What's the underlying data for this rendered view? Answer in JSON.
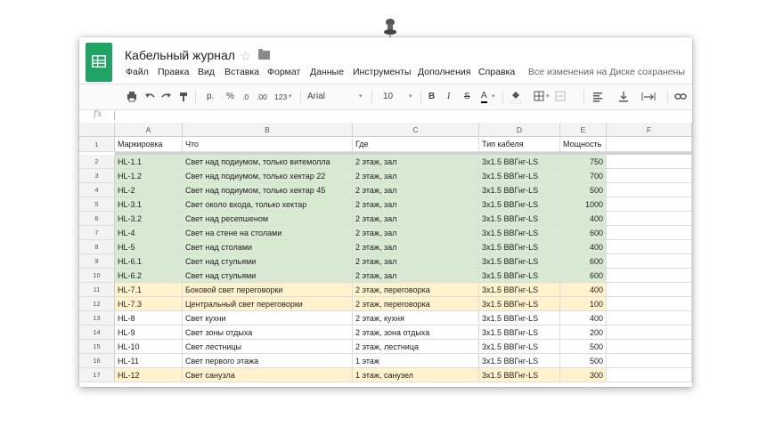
{
  "document": {
    "title": "Кабельный журнал",
    "save_status": "Все изменения на Диске сохранены"
  },
  "menu": [
    "Файл",
    "Правка",
    "Вид",
    "Вставка",
    "Формат",
    "Данные",
    "Инструменты",
    "Дополнения",
    "Справка"
  ],
  "toolbar": {
    "number_format_p": "р.",
    "percent": "%",
    "decrease_decimals": ".0",
    "increase_decimals": ".00",
    "more_formats": "123",
    "font_name": "Arial",
    "font_size": "10",
    "bold": "B",
    "italic": "I",
    "strike": "S",
    "text_color": "A"
  },
  "formula_bar": {
    "label": "fx",
    "value": ""
  },
  "columns": [
    "A",
    "B",
    "C",
    "D",
    "E",
    "F"
  ],
  "header_row": {
    "num": "1",
    "cells": [
      "Маркировка",
      "Что",
      "Где",
      "Тип кабеля",
      "Мощность",
      ""
    ]
  },
  "rows": [
    {
      "num": "2",
      "cells": [
        "HL-1.1",
        "Свет над подиумом, только витемолла",
        "2 этаж, зал",
        "3x1.5 ВВГнг-LS",
        "750",
        ""
      ],
      "fill": "green"
    },
    {
      "num": "3",
      "cells": [
        "HL-1.2",
        "Свет над подиумом, только хектар 22",
        "2 этаж, зал",
        "3x1.5 ВВГнг-LS",
        "700",
        ""
      ],
      "fill": "green"
    },
    {
      "num": "4",
      "cells": [
        "HL-2",
        "Свет над подиумом, только хектар 45",
        "2 этаж, зал",
        "3x1.5 ВВГнг-LS",
        "500",
        ""
      ],
      "fill": "green"
    },
    {
      "num": "5",
      "cells": [
        "HL-3.1",
        "Свет около входа, только хектар",
        "2 этаж, зал",
        "3x1.5 ВВГнг-LS",
        "1000",
        ""
      ],
      "fill": "green"
    },
    {
      "num": "6",
      "cells": [
        "HL-3.2",
        "Свет над ресепшеном",
        "2 этаж, зал",
        "3x1.5 ВВГнг-LS",
        "400",
        ""
      ],
      "fill": "green"
    },
    {
      "num": "7",
      "cells": [
        "HL-4",
        "Свет на стене на столами",
        "2 этаж, зал",
        "3x1.5 ВВГнг-LS",
        "600",
        ""
      ],
      "fill": "green"
    },
    {
      "num": "8",
      "cells": [
        "HL-5",
        "Свет над столами",
        "2 этаж, зал",
        "3x1.5 ВВГнг-LS",
        "400",
        ""
      ],
      "fill": "green"
    },
    {
      "num": "9",
      "cells": [
        "HL-6.1",
        "Свет над стульями",
        "2 этаж, зал",
        "3x1.5 ВВГнг-LS",
        "600",
        ""
      ],
      "fill": "green"
    },
    {
      "num": "10",
      "cells": [
        "HL-6.2",
        "Свет над стульями",
        "2 этаж, зал",
        "3x1.5 ВВГнг-LS",
        "600",
        ""
      ],
      "fill": "green"
    },
    {
      "num": "11",
      "cells": [
        "HL-7.1",
        "Боковой свет переговорки",
        "2 этаж, переговорка",
        "3x1.5 ВВГнг-LS",
        "400",
        ""
      ],
      "fill": "yellow"
    },
    {
      "num": "12",
      "cells": [
        "HL-7.3",
        "Центральный свет переговорки",
        "2 этаж, переговорка",
        "3x1.5 ВВГнг-LS",
        "100",
        ""
      ],
      "fill": "yellow"
    },
    {
      "num": "13",
      "cells": [
        "HL-8",
        "Свет кухни",
        "2 этаж, кухня",
        "3x1.5 ВВГнг-LS",
        "400",
        ""
      ],
      "fill": "none"
    },
    {
      "num": "14",
      "cells": [
        "HL-9",
        "Свет зоны отдыха",
        "2 этаж, зона отдыха",
        "3x1.5 ВВГнг-LS",
        "200",
        ""
      ],
      "fill": "none"
    },
    {
      "num": "15",
      "cells": [
        "HL-10",
        "Свет лестницы",
        "2 этаж, лестница",
        "3x1.5 ВВГнг-LS",
        "500",
        ""
      ],
      "fill": "none"
    },
    {
      "num": "16",
      "cells": [
        "HL-11",
        "Свет первого этажа",
        "1 этаж",
        "3x1.5 ВВГнг-LS",
        "500",
        ""
      ],
      "fill": "none"
    },
    {
      "num": "17",
      "cells": [
        "HL-12",
        "Свет санузла",
        "1 этаж, санузел",
        "3x1.5 ВВГнг-LS",
        "300",
        ""
      ],
      "fill": "yellow"
    }
  ],
  "colors": {
    "brand": "#1fa463",
    "fill_green": "#d9ead3",
    "fill_yellow": "#fff2cc",
    "text_color_underline": "#000000"
  },
  "icons": [
    "pushpin-icon",
    "sheets-logo-icon",
    "star-icon",
    "folder-icon",
    "print-icon",
    "undo-icon",
    "redo-icon",
    "paint-format-icon",
    "fill-color-icon",
    "borders-icon",
    "merge-icon",
    "align-left-icon",
    "valign-icon",
    "text-wrap-icon",
    "link-icon"
  ]
}
